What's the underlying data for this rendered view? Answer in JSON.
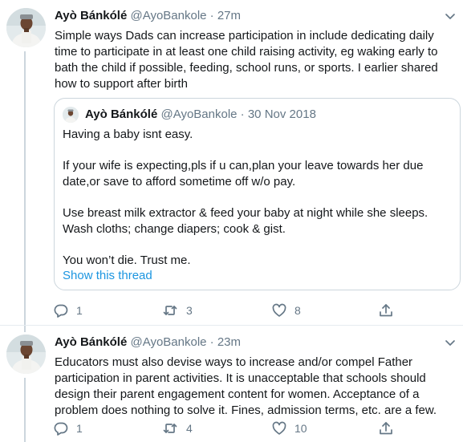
{
  "tweets": [
    {
      "name": "Ayò Bánkólé",
      "handle": "@AyoBankole",
      "dot": "·",
      "time": "27m",
      "text": "Simple ways Dads can increase participation in include dedicating daily time to participate in at least one child raising activity, eg waking early to bath the child if possible, feeding, school runs, or sports. I earlier shared how to support after birth",
      "quote": {
        "name": "Ayò Bánkólé",
        "handle": "@AyoBankole",
        "dot": "·",
        "date": "30 Nov 2018",
        "lines": [
          "Having a baby isnt easy.",
          "If your wife is expecting,pls if u can,plan your leave towards her due date,or save to afford sometime off w/o pay.",
          "Use breast milk extractor & feed your baby at night while she sleeps. Wash cloths; change diapers; cook & gist.",
          "You won’t die. Trust me."
        ],
        "show_thread": "Show this thread"
      },
      "actions": {
        "replies": "1",
        "retweets": "3",
        "likes": "8"
      }
    },
    {
      "name": "Ayò Bánkólé",
      "handle": "@AyoBankole",
      "dot": "·",
      "time": "23m",
      "text": "Educators must also devise ways to increase and/or compel Father participation in parent activities. It is unacceptable that schools should design their parent engagement content for women. Acceptance of a problem does nothing to solve it. Fines, admission terms, etc. are a few.",
      "actions": {
        "replies": "1",
        "retweets": "4",
        "likes": "10"
      }
    }
  ],
  "colors": {
    "text": "#14171a",
    "secondary": "#657786",
    "link": "#1b95e0",
    "border": "#ccd6dd",
    "divider": "#e6ecf0"
  },
  "icons": [
    "avatar",
    "chevron-down-icon",
    "reply-icon",
    "retweet-icon",
    "like-icon",
    "share-icon"
  ]
}
